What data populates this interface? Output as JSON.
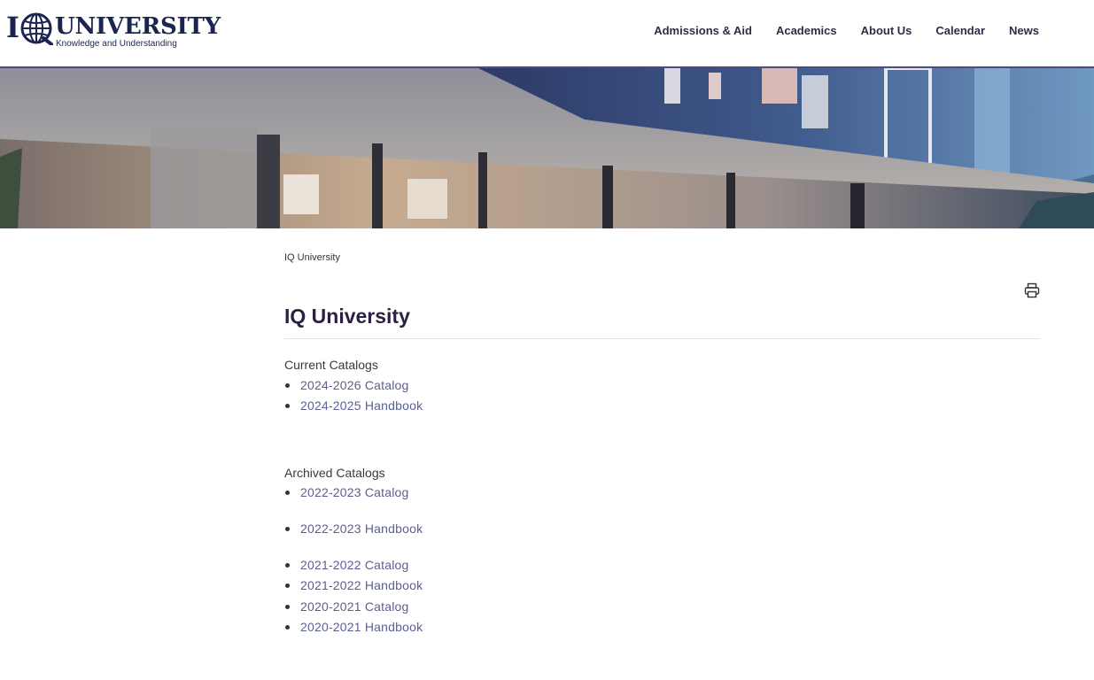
{
  "header": {
    "logo": {
      "mark": "I",
      "wordmark": "UNIVERSITY",
      "tagline": "Knowledge and Understanding"
    },
    "nav": [
      {
        "label": "Admissions & Aid"
      },
      {
        "label": "Academics"
      },
      {
        "label": "About Us"
      },
      {
        "label": "Calendar"
      },
      {
        "label": "News"
      }
    ]
  },
  "breadcrumb": "IQ University",
  "page_title": "IQ University",
  "print_icon": "printer-icon",
  "current": {
    "heading": "Current Catalogs",
    "items": [
      {
        "label": "2024-2026 Catalog"
      },
      {
        "label": "2024-2025 Handbook"
      }
    ]
  },
  "archived": {
    "heading": "Archived Catalogs",
    "items": [
      {
        "label": "2022-2023 Catalog"
      },
      {
        "label": "2022-2023 Handbook"
      },
      {
        "label": "2021-2022 Catalog"
      },
      {
        "label": "2021-2022 Handbook"
      },
      {
        "label": "2020-2021 Catalog"
      },
      {
        "label": "2020-2021 Handbook"
      }
    ]
  },
  "colors": {
    "brand_navy": "#1a2550",
    "title": "#2b1f44",
    "link": "#5a5f94",
    "header_rule": "#4a4a8a"
  }
}
